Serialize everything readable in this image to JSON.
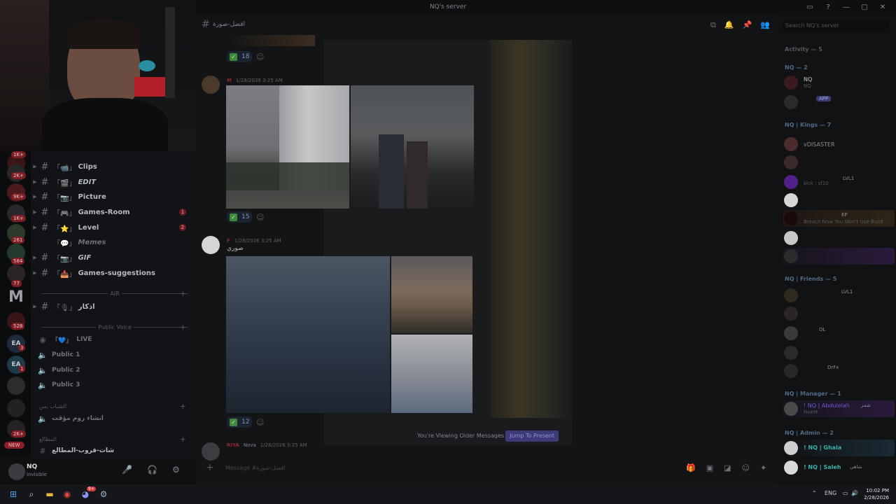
{
  "window": {
    "title": "NQ's server"
  },
  "header": {
    "channel_name": "افضل-صورة",
    "search_placeholder": "Search NQ's server"
  },
  "guild_badges": [
    "1K+",
    "2K+",
    "9K+",
    "1K+",
    "261",
    "584",
    "77",
    "528",
    "3",
    "1",
    "2K+"
  ],
  "new_badge": "NEW",
  "channels": [
    {
      "deco": "「📹」",
      "name": "Clips",
      "unread": ""
    },
    {
      "deco": "「🎬」",
      "name": "EDIT",
      "unread": ""
    },
    {
      "deco": "「📷」",
      "name": "Picture",
      "unread": ""
    },
    {
      "deco": "「🎮」",
      "name": "Games-Room",
      "unread": "1"
    },
    {
      "deco": "「⭐」",
      "name": "Level",
      "unread": "2"
    },
    {
      "deco": "「💬」",
      "name": "Memes",
      "unread": ""
    },
    {
      "deco": "「📷」",
      "name": "GIF",
      "unread": ""
    },
    {
      "deco": "「📥」",
      "name": "Games-suggestions",
      "unread": ""
    }
  ],
  "categories": {
    "air": "AIR",
    "public_voice": "Public Voice",
    "extra": "الشباب بس",
    "extra2": "المطالع"
  },
  "voice": {
    "azkar": "اذكار",
    "live": "LIVE",
    "public1": "Public 1",
    "public2": "Public 2",
    "public3": "Public 3",
    "extra": "انشاء روم مؤقت",
    "text_extra": "شات-قروب-المطالع"
  },
  "user": {
    "name": "NQ",
    "status": "Invisible"
  },
  "messages": [
    {
      "time": "1/28/2026 3:25 AM",
      "reaction": "18"
    },
    {
      "time": "1/28/2026 3:25 AM",
      "reaction": "15"
    },
    {
      "time": "1/28/2026 3:25 AM",
      "text": "صوري",
      "reaction": "12"
    },
    {
      "name": "RIYA",
      "tag": "Nova",
      "time": "1/28/2026 3:25 AM"
    }
  ],
  "jump": {
    "text": "You're Viewing Older Messages",
    "button": "Jump To Present"
  },
  "composer": {
    "placeholder": "Message #افضل-صورة"
  },
  "members": {
    "activity": "Activity — 5",
    "groups": [
      {
        "header": "NQ — 2"
      },
      {
        "header": "NQ | Kings — 7"
      },
      {
        "header": "NQ | Friends — 5"
      },
      {
        "header": "NQ | Manager — 1"
      },
      {
        "header": "NQ | Admin — 2"
      }
    ],
    "rows": {
      "nq": "NQ",
      "app": "APP",
      "disaster": "vDISASTER",
      "kick": "kick : sf10",
      "lvl1": "LVL1",
      "ep": "EP",
      "breach": "Breach Now You Won't Use Build",
      "lvl1b": "LVL1",
      "ol": "OL",
      "drfx": "DrFx",
      "manager": "! NQ | Abdulelah",
      "manager_sub": "FiveM",
      "manager_tag": "شمز",
      "ghala": "! NQ | Ghala",
      "saleh": "! NQ | Saleh",
      "saleh_tag": "شاهي"
    }
  },
  "taskbar": {
    "lang": "ENG",
    "time": "10:02 PM",
    "date": "2/28/2026",
    "discord_badge": "9+"
  }
}
